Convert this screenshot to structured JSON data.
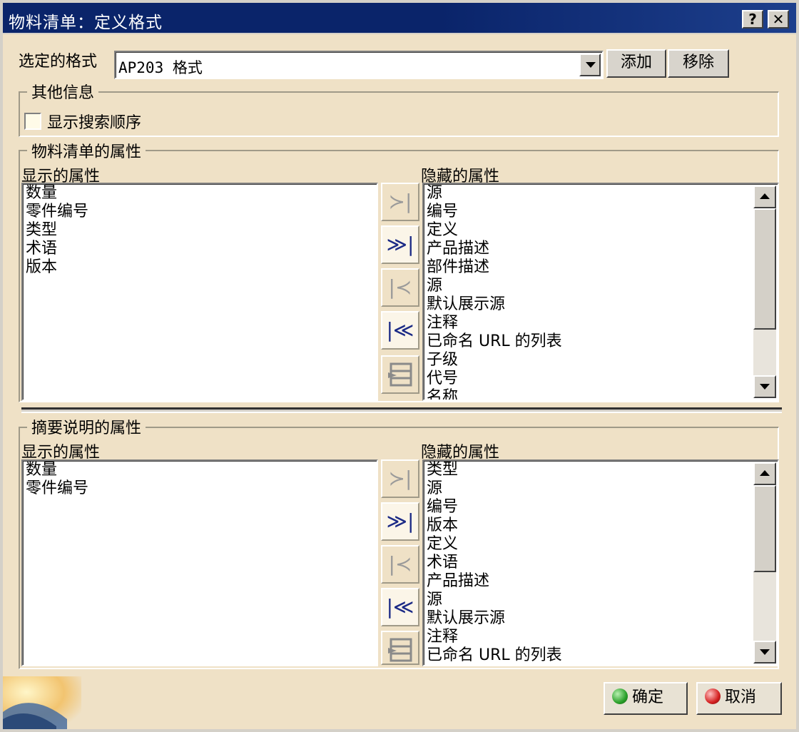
{
  "window": {
    "title": "物料清单：定义格式",
    "help_label": "?",
    "close_label": "✕"
  },
  "format": {
    "label": "选定的格式",
    "selected": "AP203 格式",
    "add_label": "添加",
    "remove_label": "移除"
  },
  "other_info": {
    "title": "其他信息",
    "show_search_order_label": "显示搜索顺序",
    "show_search_order_checked": false
  },
  "bom_props": {
    "title": "物料清单的属性",
    "displayed_label": "显示的属性",
    "hidden_label": "隐藏的属性",
    "displayed": [
      "数量",
      "零件编号",
      "类型",
      "术语",
      "版本"
    ],
    "hidden": [
      "源",
      "编号",
      "定义",
      "产品描述",
      "部件描述",
      "源",
      "默认展示源",
      "注释",
      "已命名 URL 的列表",
      "子级",
      "代号",
      "名称"
    ]
  },
  "summary_props": {
    "title": "摘要说明的属性",
    "displayed_label": "显示的属性",
    "hidden_label": "隐藏的属性",
    "displayed": [
      "数量",
      "零件编号"
    ],
    "hidden": [
      "类型",
      "源",
      "编号",
      "版本",
      "定义",
      "术语",
      "产品描述",
      "源",
      "默认展示源",
      "注释",
      "已命名 URL 的列表"
    ]
  },
  "move_buttons": {
    "move_one": "≻|",
    "move_all": "≫|",
    "remove_one": "|≺",
    "remove_all": "|≪"
  },
  "footer": {
    "ok_label": "确定",
    "cancel_label": "取消"
  },
  "colors": {
    "title_bar": "#0a246a",
    "panel_bg": "#efe1c6",
    "ok_orb": "#2aa02a",
    "cancel_orb": "#d42020"
  }
}
